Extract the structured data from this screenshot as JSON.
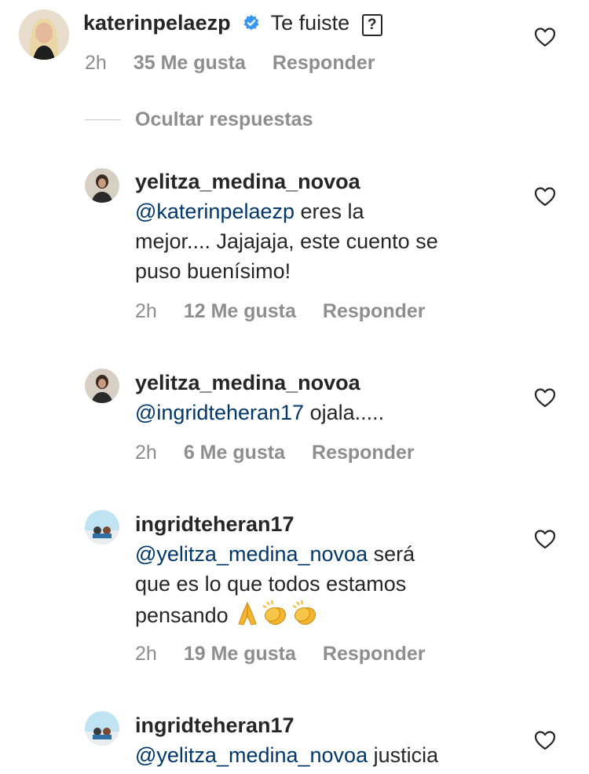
{
  "comment_main": {
    "username": "katerinpelaezp",
    "text": "Te fuiste",
    "trailing_glyph": "?",
    "time": "2h",
    "likes": "35 Me gusta",
    "reply": "Responder"
  },
  "hide_replies": "Ocultar respuestas",
  "replies": [
    {
      "username": "yelitza_medina_novoa",
      "mention": "@katerinpelaezp",
      "line1": " eres la",
      "line2": "mejor.... Jajajaja, este cuento se",
      "line3": "puso buenísimo!",
      "time": "2h",
      "likes": "12 Me gusta",
      "reply": "Responder"
    },
    {
      "username": "yelitza_medina_novoa",
      "mention": "@ingridteheran17",
      "line1": " ojala.....",
      "time": "2h",
      "likes": "6 Me gusta",
      "reply": "Responder"
    },
    {
      "username": "ingridteheran17",
      "mention": "@yelitza_medina_novoa",
      "line1": " será",
      "line2": "que es lo que todos estamos",
      "line3": "pensando",
      "emojis": [
        "folded-hands-emoji",
        "clapping-hands-emoji",
        "clapping-hands-emoji"
      ],
      "time": "2h",
      "likes": "19 Me gusta",
      "reply": "Responder"
    },
    {
      "username": "ingridteheran17",
      "mention": "@yelitza_medina_novoa",
      "line1": " justicia"
    }
  ],
  "colors": {
    "text": "#262626",
    "meta": "#8e8e8e",
    "mention": "#00376b",
    "verified": "#3897f0"
  }
}
